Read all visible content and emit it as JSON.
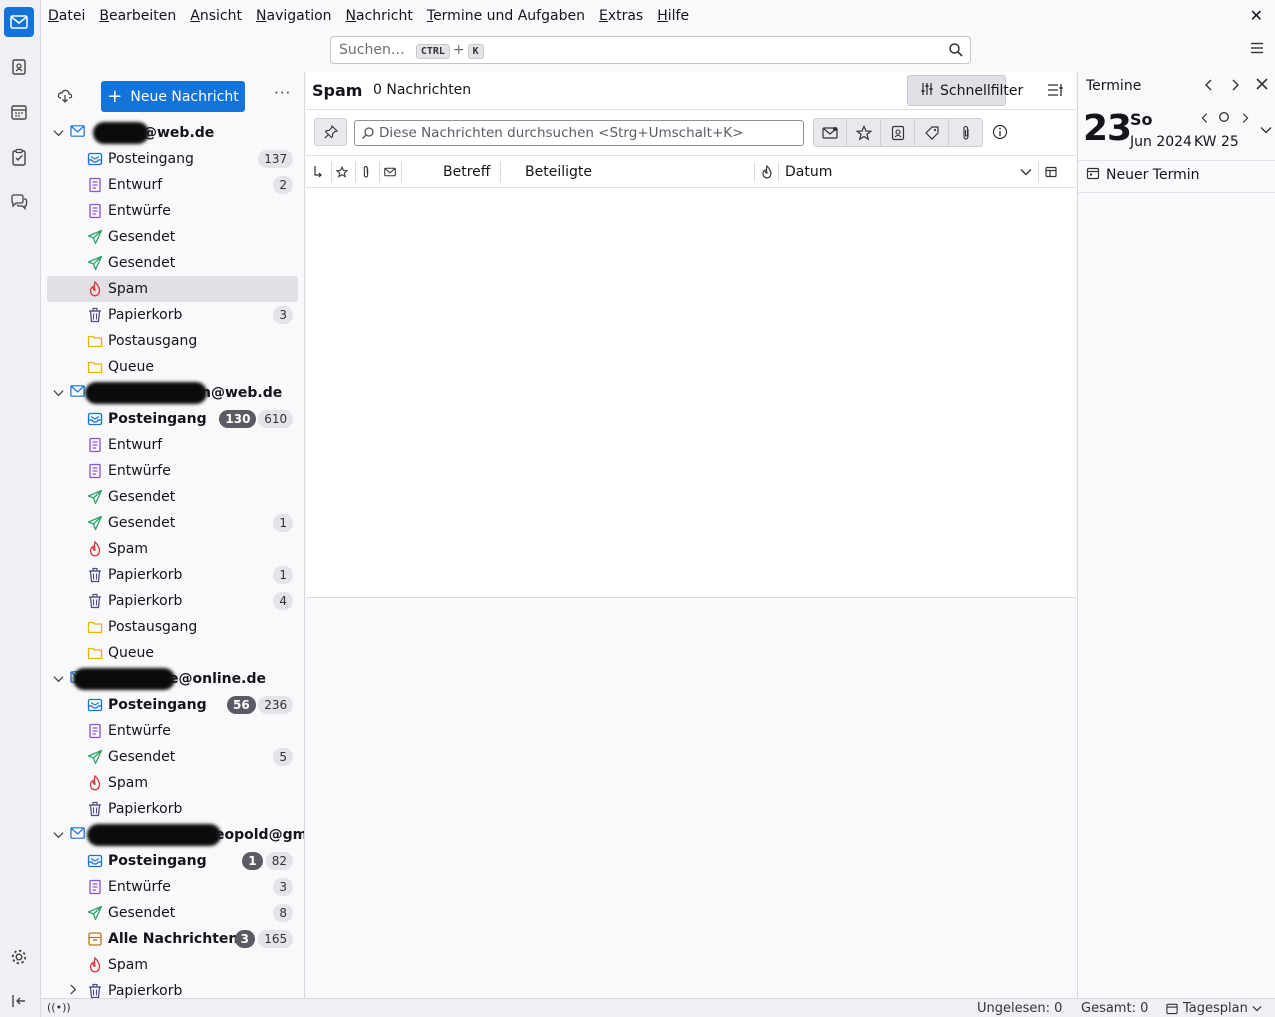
{
  "menubar": {
    "items": [
      {
        "ul": "D",
        "rest": "atei"
      },
      {
        "ul": "B",
        "rest": "earbeiten"
      },
      {
        "ul": "A",
        "rest": "nsicht"
      },
      {
        "ul": "N",
        "rest": "avigation"
      },
      {
        "ul": "N",
        "rest": "achricht"
      },
      {
        "ul": "T",
        "rest": "ermine und Aufgaben"
      },
      {
        "ul": "E",
        "rest": "xtras"
      },
      {
        "ul": "H",
        "rest": "ilfe"
      }
    ],
    "close": "✕"
  },
  "search": {
    "placeholder": "Suchen…",
    "key1": "CTRL",
    "plus": "+",
    "key2": "K"
  },
  "folder_pane": {
    "new_message": "Neue Nachricht",
    "more": "···"
  },
  "accounts": [
    {
      "name": "@web.de",
      "folders": [
        {
          "name": "Posteingang",
          "type": "inbox",
          "total": "137"
        },
        {
          "name": "Entwurf",
          "type": "draft",
          "total": "2"
        },
        {
          "name": "Entwürfe",
          "type": "draft"
        },
        {
          "name": "Gesendet",
          "type": "sent"
        },
        {
          "name": "Gesendet",
          "type": "sent"
        },
        {
          "name": "Spam",
          "type": "spam",
          "selected": true
        },
        {
          "name": "Papierkorb",
          "type": "trash",
          "total": "3"
        },
        {
          "name": "Postausgang",
          "type": "folder"
        },
        {
          "name": "Queue",
          "type": "folder"
        }
      ]
    },
    {
      "name": "n@web.de",
      "folders": [
        {
          "name": "Posteingang",
          "type": "inbox",
          "bold": true,
          "unread": "130",
          "total": "610"
        },
        {
          "name": "Entwurf",
          "type": "draft"
        },
        {
          "name": "Entwürfe",
          "type": "draft"
        },
        {
          "name": "Gesendet",
          "type": "sent"
        },
        {
          "name": "Gesendet",
          "type": "sent",
          "total": "1"
        },
        {
          "name": "Spam",
          "type": "spam"
        },
        {
          "name": "Papierkorb",
          "type": "trash",
          "total": "1"
        },
        {
          "name": "Papierkorb",
          "type": "trash",
          "total": "4"
        },
        {
          "name": "Postausgang",
          "type": "folder"
        },
        {
          "name": "Queue",
          "type": "folder"
        }
      ]
    },
    {
      "name": "e@online.de",
      "folders": [
        {
          "name": "Posteingang",
          "type": "inbox",
          "bold": true,
          "unread": "56",
          "total": "236"
        },
        {
          "name": "Entwürfe",
          "type": "draft"
        },
        {
          "name": "Gesendet",
          "type": "sent",
          "total": "5"
        },
        {
          "name": "Spam",
          "type": "spam"
        },
        {
          "name": "Papierkorb",
          "type": "trash"
        }
      ]
    },
    {
      "name": "eopold@gmai…",
      "folders": [
        {
          "name": "Posteingang",
          "type": "inbox",
          "bold": true,
          "unread": "1",
          "total": "82"
        },
        {
          "name": "Entwürfe",
          "type": "draft",
          "total": "3"
        },
        {
          "name": "Gesendet",
          "type": "sent",
          "total": "8"
        },
        {
          "name": "Alle Nachrichten",
          "type": "archive",
          "bold": true,
          "unread": "3",
          "total": "165"
        },
        {
          "name": "Spam",
          "type": "spam"
        },
        {
          "name": "Papierkorb",
          "type": "trash",
          "collapsed": true
        }
      ]
    }
  ],
  "thread_pane": {
    "folder_name": "Spam",
    "message_count": "0 Nachrichten",
    "quick_filter": "Schnellfilter",
    "filter_placeholder": "Diese Nachrichten durchsuchen <Strg+Umschalt+K>",
    "columns": {
      "subject": "Betreff",
      "correspondents": "Beteiligte",
      "date": "Datum"
    }
  },
  "today_pane": {
    "title": "Termine",
    "day": "23",
    "weekday": "So",
    "month_year": "Jun 2024",
    "week": "KW 25",
    "new_event": "Neuer Termin"
  },
  "statusbar": {
    "unread": "Ungelesen: 0",
    "total": "Gesamt: 0",
    "today_pane": "Tagesplan"
  },
  "colors": {
    "accent": "#1373d9",
    "inbox": "#1373d9",
    "draft": "#8c4fd6",
    "sent": "#2ca36b",
    "spam": "#d83a3a",
    "trash": "#4d4d80",
    "folder": "#e6b400",
    "archive": "#b07a2a"
  }
}
